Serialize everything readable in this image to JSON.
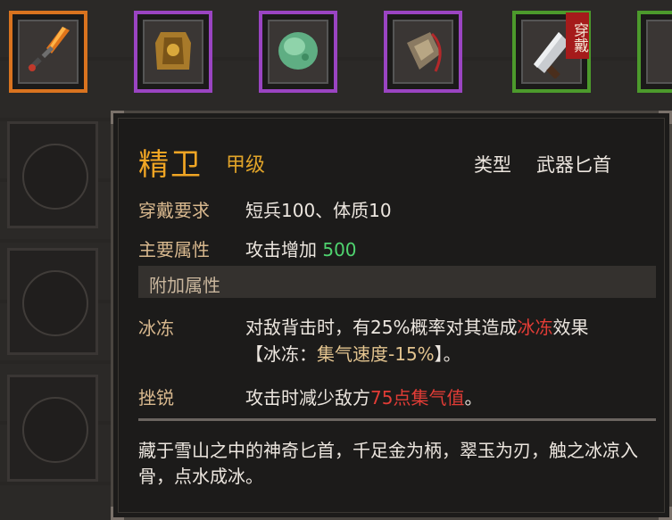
{
  "inventory": {
    "top_slots": [
      {
        "icon": "flame-dagger-icon",
        "rarity": "orange"
      },
      {
        "icon": "gold-armor-icon",
        "rarity": "purple"
      },
      {
        "icon": "jade-stone-icon",
        "rarity": "purple"
      },
      {
        "icon": "stone-talisman-icon",
        "rarity": "purple"
      },
      {
        "icon": "cleaver-icon",
        "rarity": "green",
        "tag": "穿戴"
      }
    ]
  },
  "tooltip": {
    "name": "精卫",
    "grade": "甲级",
    "type_label": "类型",
    "type_value": "武器匕首",
    "requirement_label": "穿戴要求",
    "requirement_value": "短兵100、体质10",
    "main_attr_label": "主要属性",
    "main_attr_text": "攻击增加",
    "main_attr_value": "500",
    "extra_section_label": "附加属性",
    "freeze_label": "冰冻",
    "freeze_text_1": "对敌背击时，有25%概率对其造成",
    "freeze_highlight": "冰冻",
    "freeze_text_2": "效果",
    "freeze_detail_open": "【冰冻：",
    "freeze_detail_effect": "集气速度-15%",
    "freeze_detail_close": "】。",
    "blunt_label": "挫锐",
    "blunt_text": "攻击时减少敌方",
    "blunt_highlight": "75点集气值",
    "blunt_end": "。",
    "flavor_text": "藏于雪山之中的神奇匕首，千足金为柄，翠玉为刃，触之冰凉入骨，点水成冰。"
  },
  "colors": {
    "rarity_orange": "#d9731f",
    "rarity_purple": "#9a44c2",
    "rarity_green": "#4c9a2c",
    "name_gold": "#f0a524",
    "value_green": "#4fd36f",
    "highlight_red": "#e23c36"
  }
}
